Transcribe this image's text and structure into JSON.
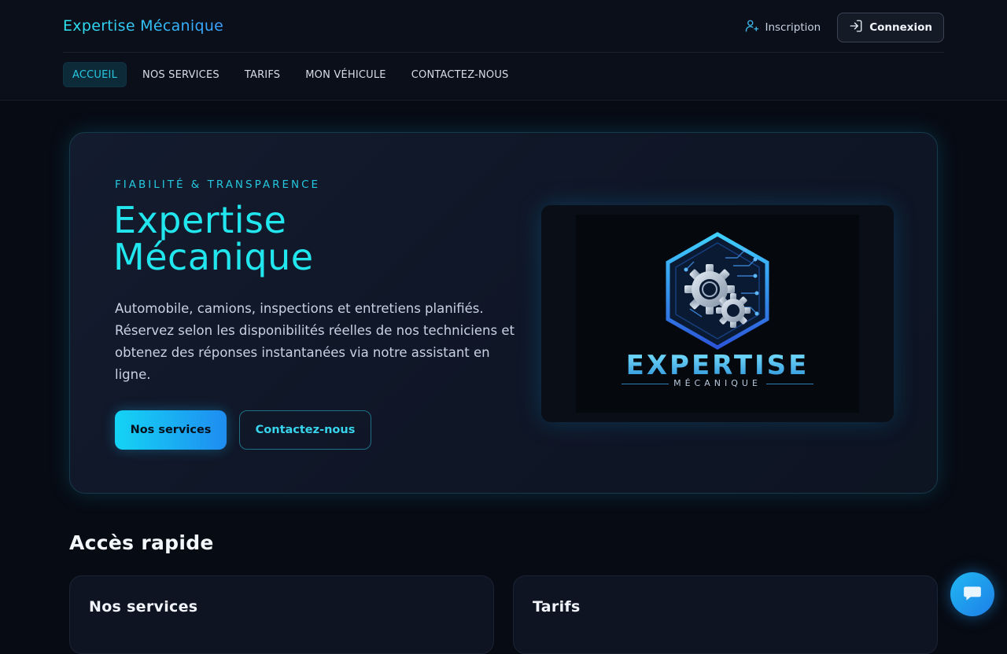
{
  "header": {
    "brand": "Expertise Mécanique",
    "inscription_label": "Inscription",
    "connexion_label": "Connexion"
  },
  "nav": {
    "items": [
      {
        "label": "ACCUEIL",
        "active": true
      },
      {
        "label": "NOS SERVICES",
        "active": false
      },
      {
        "label": "TARIFS",
        "active": false
      },
      {
        "label": "MON VÉHICULE",
        "active": false
      },
      {
        "label": "CONTACTEZ-NOUS",
        "active": false
      }
    ]
  },
  "hero": {
    "eyebrow": "FIABILITÉ & TRANSPARENCE",
    "title": "Expertise Mécanique",
    "description": "Automobile, camions, inspections et entretiens planifiés. Réservez selon les disponibilités réelles de nos techniciens et obtenez des réponses instantanées via notre assistant en ligne.",
    "primary_button": "Nos services",
    "secondary_button": "Contactez-nous",
    "logo_word": "EXPERTISE",
    "logo_sub": "MÉCANIQUE"
  },
  "quick_access": {
    "title": "Accès rapide",
    "cards": [
      {
        "title": "Nos services",
        "text": ""
      },
      {
        "title": "Tarifs",
        "text": ""
      }
    ]
  },
  "colors": {
    "accent": "#22e6ee",
    "primary_blue": "#1f8cf0",
    "background": "#070b14"
  },
  "icons": {
    "inscription": "user-add-icon",
    "connexion": "login-icon",
    "chat": "chat-bubble-icon"
  }
}
